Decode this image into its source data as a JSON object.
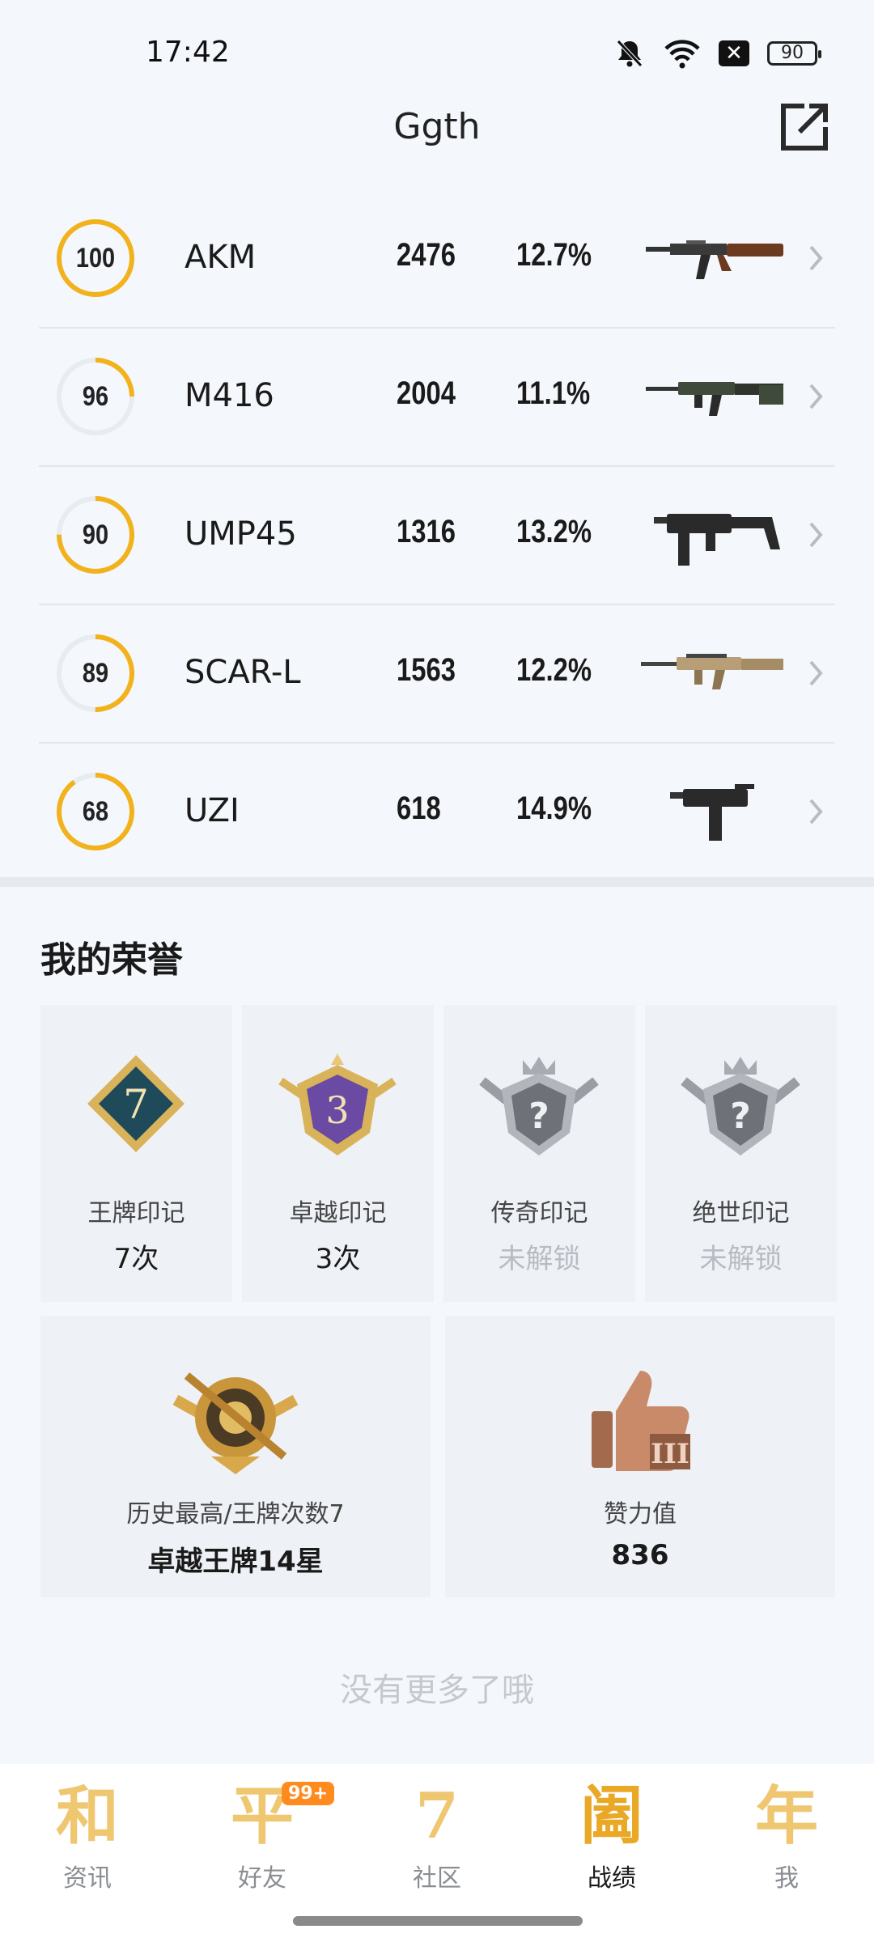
{
  "status_bar": {
    "time": "17:42",
    "battery": "90"
  },
  "header": {
    "title": "Ggth",
    "share_icon": "share-out-icon"
  },
  "weapons": [
    {
      "score": "100",
      "score_fill": 1.0,
      "name": "AKM",
      "kills": "2476",
      "rate": "12.7%"
    },
    {
      "score": "96",
      "score_fill": 0.25,
      "name": "M416",
      "kills": "2004",
      "rate": "11.1%"
    },
    {
      "score": "90",
      "score_fill": 0.75,
      "name": "UMP45",
      "kills": "1316",
      "rate": "13.2%"
    },
    {
      "score": "89",
      "score_fill": 0.5,
      "name": "SCAR-L",
      "kills": "1563",
      "rate": "12.2%"
    },
    {
      "score": "68",
      "score_fill": 0.9,
      "name": "UZI",
      "kills": "618",
      "rate": "14.9%"
    }
  ],
  "honors": {
    "title": "我的荣誉",
    "badges": [
      {
        "name": "王牌印记",
        "value": "7次",
        "emblem": "7"
      },
      {
        "name": "卓越印记",
        "value": "3次",
        "emblem": "3"
      },
      {
        "name": "传奇印记",
        "value": "未解锁",
        "emblem": "?"
      },
      {
        "name": "绝世印记",
        "value": "未解锁",
        "emblem": "?"
      }
    ],
    "history": {
      "name": "历史最高/王牌次数7",
      "value": "卓越王牌14星"
    },
    "likes": {
      "name": "赞力值",
      "value": "836"
    }
  },
  "footer_text": "没有更多了哦",
  "nav": {
    "items": [
      {
        "glyph": "和",
        "label": "资讯"
      },
      {
        "glyph": "平",
        "label": "好友",
        "badge": "99+"
      },
      {
        "glyph": "7",
        "label": "社区"
      },
      {
        "glyph": "阖",
        "label": "战绩"
      },
      {
        "glyph": "年",
        "label": "我"
      }
    ],
    "active_index": 3
  },
  "colors": {
    "ring": "#f2b21c",
    "ring_track": "#e8ebef",
    "bg": "#f4f7fb",
    "card": "#eef1f6",
    "nav_glyph": "#efc771"
  }
}
